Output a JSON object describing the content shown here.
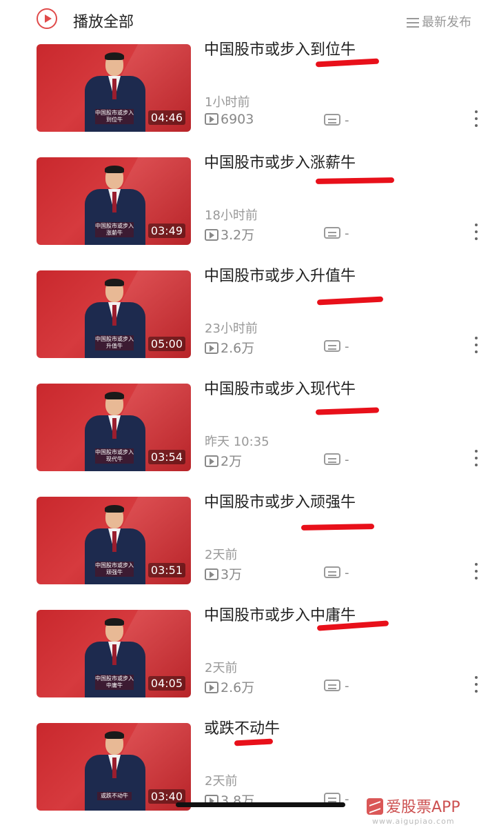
{
  "header": {
    "play_all_label": "播放全部",
    "sort_label": "最新发布"
  },
  "videos": [
    {
      "title": "中国股市或步入到位牛",
      "caption": "中国股市或步入到位牛",
      "duration": "04:46",
      "time": "1小时前",
      "views": "6903",
      "comments": "-"
    },
    {
      "title": "中国股市或步入涨薪牛",
      "caption": "中国股市或步入涨薪牛",
      "duration": "03:49",
      "time": "18小时前",
      "views": "3.2万",
      "comments": "-"
    },
    {
      "title": "中国股市或步入升值牛",
      "caption": "中国股市或步入升值牛",
      "duration": "05:00",
      "time": "23小时前",
      "views": "2.6万",
      "comments": "-"
    },
    {
      "title": "中国股市或步入现代牛",
      "caption": "中国股市或步入现代牛",
      "duration": "03:54",
      "time": "昨天 10:35",
      "views": "2万",
      "comments": "-"
    },
    {
      "title": "中国股市或步入顽强牛",
      "caption": "中国股市或步入顽强牛",
      "duration": "03:51",
      "time": "2天前",
      "views": "3万",
      "comments": "-"
    },
    {
      "title": "中国股市或步入中庸牛",
      "caption": "中国股市或步入中庸牛",
      "duration": "04:05",
      "time": "2天前",
      "views": "2.6万",
      "comments": "-"
    },
    {
      "title": "或跌不动牛",
      "caption": "或跌不动牛",
      "duration": "03:40",
      "time": "2天前",
      "views": "3.8万",
      "comments": "-"
    }
  ],
  "watermark": {
    "brand": "爱股票APP",
    "url": "www.aigupiao.com"
  },
  "colors": {
    "accent": "#e04a4a",
    "highlight": "#e8101a",
    "thumb_red": "#c9282d"
  }
}
